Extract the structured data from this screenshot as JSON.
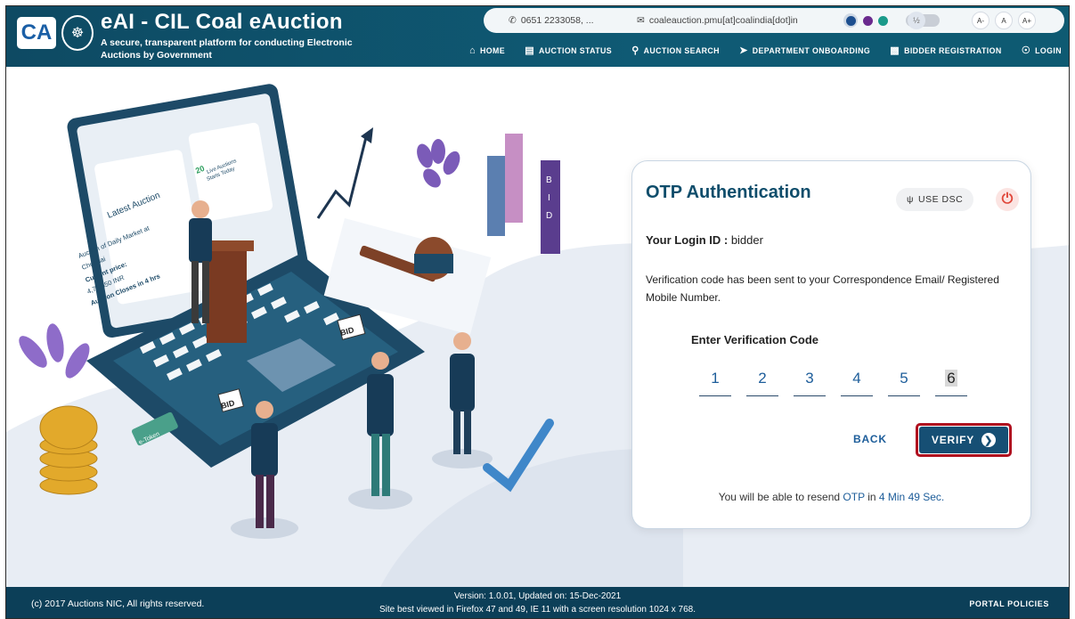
{
  "header": {
    "logo_text": "CA",
    "title": "eAI - CIL Coal eAuction",
    "subtitle": "A secure, transparent platform for conducting Electronic Auctions by Government"
  },
  "topbar": {
    "phone": "0651 2233058, ...",
    "email": "coaleauction.pmu[at]coalindia[dot]in",
    "font_small": "A-",
    "font_normal": "A",
    "font_large": "A+"
  },
  "nav": {
    "items": [
      {
        "label": "HOME",
        "icon": "home-icon"
      },
      {
        "label": "AUCTION STATUS",
        "icon": "status-icon"
      },
      {
        "label": "AUCTION SEARCH",
        "icon": "search-icon"
      },
      {
        "label": "DEPARTMENT ONBOARDING",
        "icon": "rocket-icon"
      },
      {
        "label": "BIDDER REGISTRATION",
        "icon": "id-card-icon"
      },
      {
        "label": "LOGIN",
        "icon": "login-icon"
      }
    ]
  },
  "illustration": {
    "latest_title": "Latest Auction",
    "latest_lines": [
      "Auction of Daily Market at",
      "Chennai",
      "Current price:",
      "4,75,550 INR",
      "Auction Closes in 4 hrs"
    ],
    "live_count": "20",
    "live_text": "Live Auctions",
    "live_text2": "Starts Today",
    "bid_label": "BID",
    "token_label": "e-Token"
  },
  "otp": {
    "title": "OTP Authentication",
    "use_dsc": "USE DSC",
    "login_id_label": "Your Login ID :",
    "login_id_value": "bidder",
    "message": "Verification code has been sent to your Correspondence Email/ Registered Mobile Number.",
    "enter_label": "Enter Verification Code",
    "digits": [
      "1",
      "2",
      "3",
      "4",
      "5",
      "6"
    ],
    "back": "BACK",
    "verify": "VERIFY",
    "resend_prefix": "You will be able to resend",
    "resend_otp": "OTP",
    "resend_in": "in",
    "resend_time": "4 Min 49 Sec."
  },
  "footer": {
    "copyright": "(c) 2017 Auctions NIC, All rights reserved.",
    "version": "Version: 1.0.01, Updated on: 15-Dec-2021",
    "browser_note": "Site best viewed in Firefox 47 and 49, IE 11 with a screen resolution 1024 x 768.",
    "policies": "PORTAL POLICIES"
  },
  "colors": {
    "header_bg": "#0f5a74",
    "footer_bg": "#0c3f58",
    "primary": "#164f74",
    "verify_outline": "#b00f1f",
    "link_blue": "#1d5d9a"
  }
}
